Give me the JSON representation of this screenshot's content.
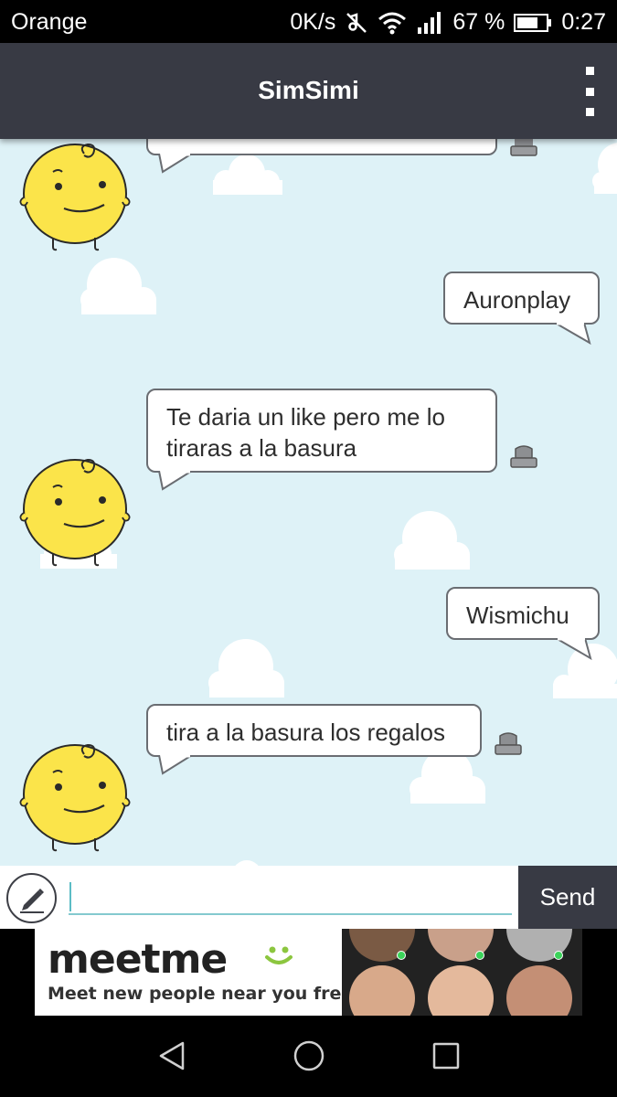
{
  "status_bar": {
    "carrier": "Orange",
    "network_speed": "0K/s",
    "battery": "67 %",
    "time": "0:27",
    "icons": [
      "mute-icon",
      "wifi-icon",
      "signal-icon",
      "battery-icon"
    ]
  },
  "app_bar": {
    "title": "SimSimi",
    "menu_icon": "overflow-menu-icon"
  },
  "messages": [
    {
      "from": "bot",
      "text": ""
    },
    {
      "from": "user",
      "text": "Auronplay"
    },
    {
      "from": "bot",
      "text": "Te daria un like pero me lo tiraras a la basura"
    },
    {
      "from": "user",
      "text": "Wismichu"
    },
    {
      "from": "bot",
      "text": "tira a la basura los regalos"
    }
  ],
  "input": {
    "value": "",
    "placeholder": "",
    "send_label": "Send",
    "compose_icon": "pencil-icon"
  },
  "ad": {
    "brand": "meetme",
    "tagline": "Meet new people near you free!"
  },
  "nav_bar": {
    "icons": [
      "back-icon",
      "home-icon",
      "recents-icon"
    ]
  },
  "colors": {
    "app_bar": "#383a44",
    "chat_background": "#def2f7",
    "avatar_yellow": "#fbe44a",
    "input_underline": "#84c9cf",
    "send_button": "#383a44"
  }
}
